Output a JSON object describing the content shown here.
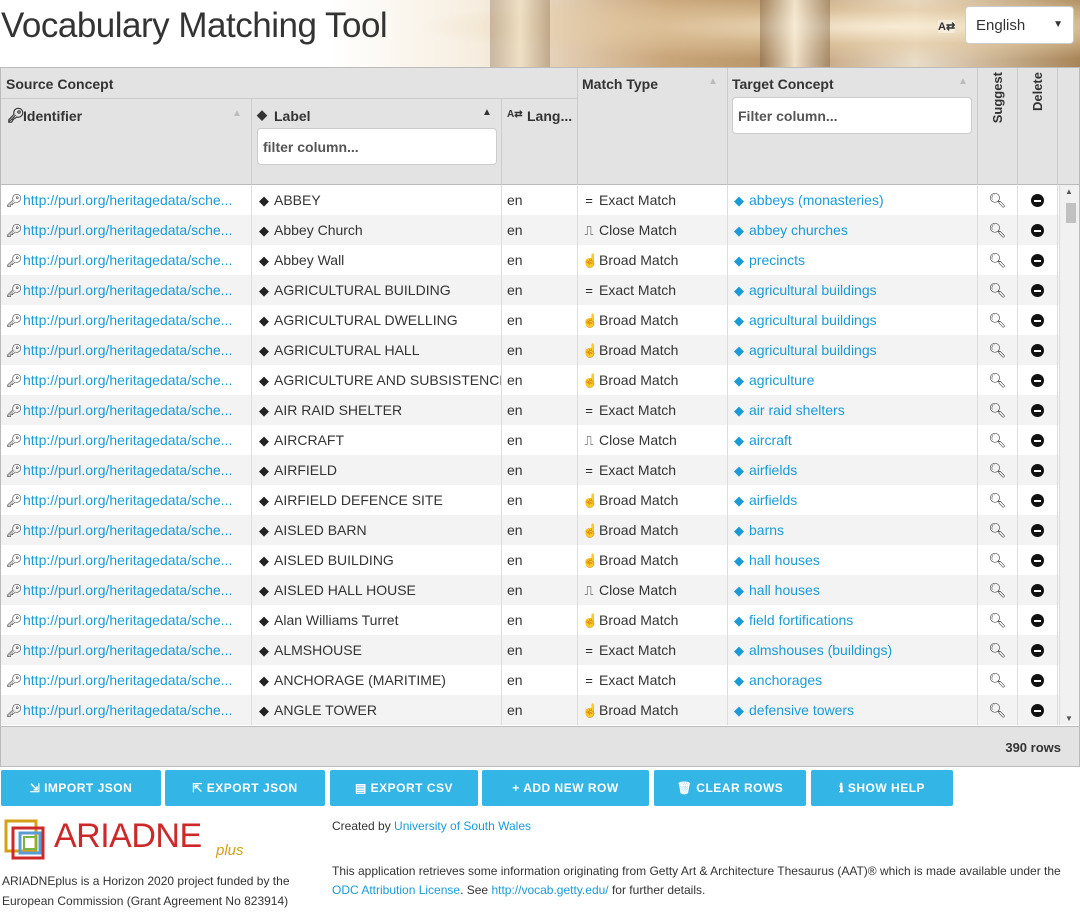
{
  "header": {
    "title": "Vocabulary Matching Tool",
    "lang_icon": "A⇄",
    "language": "English"
  },
  "grid": {
    "group_source": "Source Concept",
    "col_identifier": "Identifier",
    "col_label": "Label",
    "col_lang": "Lang...",
    "col_match": "Match Type",
    "col_target": "Target Concept",
    "col_suggest": "Suggest",
    "col_delete": "Delete",
    "filter_label_placeholder": "filter column...",
    "filter_target_placeholder": "Filter column...",
    "row_count": "390 rows",
    "rows": [
      {
        "id": "http://purl.org/heritagedata/sche...",
        "label": "ABBEY",
        "lang": "en",
        "match": "Exact Match",
        "match_icon": "equals-icon",
        "target": "abbeys (monasteries)"
      },
      {
        "id": "http://purl.org/heritagedata/sche...",
        "label": "Abbey Church",
        "lang": "en",
        "match": "Close Match",
        "match_icon": "wave-icon",
        "target": "abbey churches"
      },
      {
        "id": "http://purl.org/heritagedata/sche...",
        "label": "Abbey Wall",
        "lang": "en",
        "match": "Broad Match",
        "match_icon": "hand-icon",
        "target": "precincts"
      },
      {
        "id": "http://purl.org/heritagedata/sche...",
        "label": "AGRICULTURAL BUILDING",
        "lang": "en",
        "match": "Exact Match",
        "match_icon": "equals-icon",
        "target": "agricultural buildings"
      },
      {
        "id": "http://purl.org/heritagedata/sche...",
        "label": "AGRICULTURAL DWELLING",
        "lang": "en",
        "match": "Broad Match",
        "match_icon": "hand-icon",
        "target": "agricultural buildings"
      },
      {
        "id": "http://purl.org/heritagedata/sche...",
        "label": "AGRICULTURAL HALL",
        "lang": "en",
        "match": "Broad Match",
        "match_icon": "hand-icon",
        "target": "agricultural buildings"
      },
      {
        "id": "http://purl.org/heritagedata/sche...",
        "label": "AGRICULTURE AND SUBSISTENCE",
        "lang": "en",
        "match": "Broad Match",
        "match_icon": "hand-icon",
        "target": "agriculture"
      },
      {
        "id": "http://purl.org/heritagedata/sche...",
        "label": "AIR RAID SHELTER",
        "lang": "en",
        "match": "Exact Match",
        "match_icon": "equals-icon",
        "target": "air raid shelters"
      },
      {
        "id": "http://purl.org/heritagedata/sche...",
        "label": "AIRCRAFT",
        "lang": "en",
        "match": "Close Match",
        "match_icon": "wave-icon",
        "target": "aircraft"
      },
      {
        "id": "http://purl.org/heritagedata/sche...",
        "label": "AIRFIELD",
        "lang": "en",
        "match": "Exact Match",
        "match_icon": "equals-icon",
        "target": "airfields"
      },
      {
        "id": "http://purl.org/heritagedata/sche...",
        "label": "AIRFIELD DEFENCE SITE",
        "lang": "en",
        "match": "Broad Match",
        "match_icon": "hand-icon",
        "target": "airfields"
      },
      {
        "id": "http://purl.org/heritagedata/sche...",
        "label": "AISLED BARN",
        "lang": "en",
        "match": "Broad Match",
        "match_icon": "hand-icon",
        "target": "barns"
      },
      {
        "id": "http://purl.org/heritagedata/sche...",
        "label": "AISLED BUILDING",
        "lang": "en",
        "match": "Broad Match",
        "match_icon": "hand-icon",
        "target": "hall houses"
      },
      {
        "id": "http://purl.org/heritagedata/sche...",
        "label": "AISLED HALL HOUSE",
        "lang": "en",
        "match": "Close Match",
        "match_icon": "wave-icon",
        "target": "hall houses"
      },
      {
        "id": "http://purl.org/heritagedata/sche...",
        "label": "Alan Williams Turret",
        "lang": "en",
        "match": "Broad Match",
        "match_icon": "hand-icon",
        "target": "field fortifications"
      },
      {
        "id": "http://purl.org/heritagedata/sche...",
        "label": "ALMSHOUSE",
        "lang": "en",
        "match": "Exact Match",
        "match_icon": "equals-icon",
        "target": "almshouses (buildings)"
      },
      {
        "id": "http://purl.org/heritagedata/sche...",
        "label": "ANCHORAGE (MARITIME)",
        "lang": "en",
        "match": "Exact Match",
        "match_icon": "equals-icon",
        "target": "anchorages"
      },
      {
        "id": "http://purl.org/heritagedata/sche...",
        "label": "ANGLE TOWER",
        "lang": "en",
        "match": "Broad Match",
        "match_icon": "hand-icon",
        "target": "defensive towers"
      }
    ]
  },
  "buttons": {
    "import_json": "IMPORT JSON",
    "export_json": "EXPORT JSON",
    "export_csv": "EXPORT CSV",
    "add_new_row": "ADD NEW ROW",
    "clear_rows": "CLEAR ROWS",
    "show_help": "SHOW HELP"
  },
  "footer": {
    "logo_text": "ARIADNE",
    "logo_plus": "plus",
    "funding_text": "ARIADNEplus is a Horizon 2020 project funded by the European Commission (Grant Agreement No 823914)",
    "created_by": "Created by",
    "created_by_link": "University of South Wales",
    "info_text": "This application retrieves some information originating from Getty Art & Architecture Thesaurus (AAT)® which is made available under the",
    "odc_link": "ODC Attribution License",
    "see_text": ". See",
    "getty_link": "http://vocab.getty.edu/",
    "further_text": "for further details."
  },
  "colors": {
    "accent": "#33b5e5",
    "link": "#1a9bd7",
    "logo_red": "#cc2a2a"
  }
}
